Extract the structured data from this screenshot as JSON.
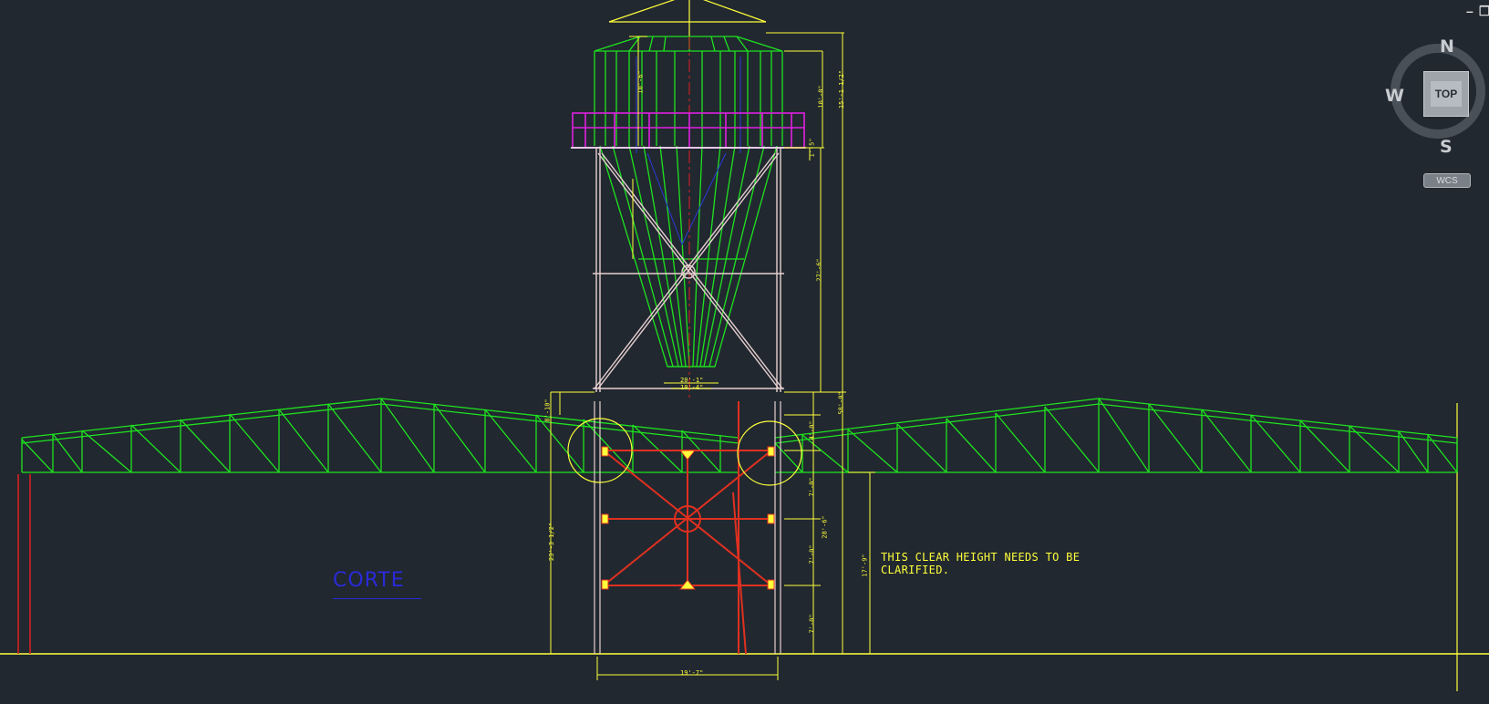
{
  "annotation": {
    "line1": "THIS CLEAR HEIGHT NEEDS TO BE",
    "line2": "CLARIFIED."
  },
  "section_label": "CORTE",
  "viewcube": {
    "north": "N",
    "south": "S",
    "west": "W",
    "face": "TOP",
    "coord_system": "WCS"
  },
  "window_controls": {
    "minimize": "–",
    "restore": "❐"
  },
  "dimensions": {
    "top_cone": "10'-6\"",
    "upper_right_a": "10'-0\"",
    "upper_right_b": "15'-1 1/2\"",
    "platform": "1'-5\"",
    "mid_right": "27'-6\"",
    "overall_right": "58'-0\"",
    "outlet_a": "20'-1\"",
    "outlet_b": "10'-4\"",
    "base_left_top": "8'-10\"",
    "base_left_overall": "23'-3 1/2\"",
    "leg_1": "4'-0\"",
    "leg_2": "7'-0\"",
    "leg_3": "28'-6\"",
    "leg_4": "7'-0\"",
    "leg_5": "7'-0\"",
    "clear_height": "17'-9\"",
    "bottom_width": "19'-7\""
  },
  "colors": {
    "background": "#212830",
    "truss": "#1fe31f",
    "dimension": "#ffff3a",
    "platform": "#e020e0",
    "frame": "#e8d0d0",
    "base_brace": "#e03020",
    "centerline": "#e02020",
    "section_label": "#2a2ad8"
  }
}
